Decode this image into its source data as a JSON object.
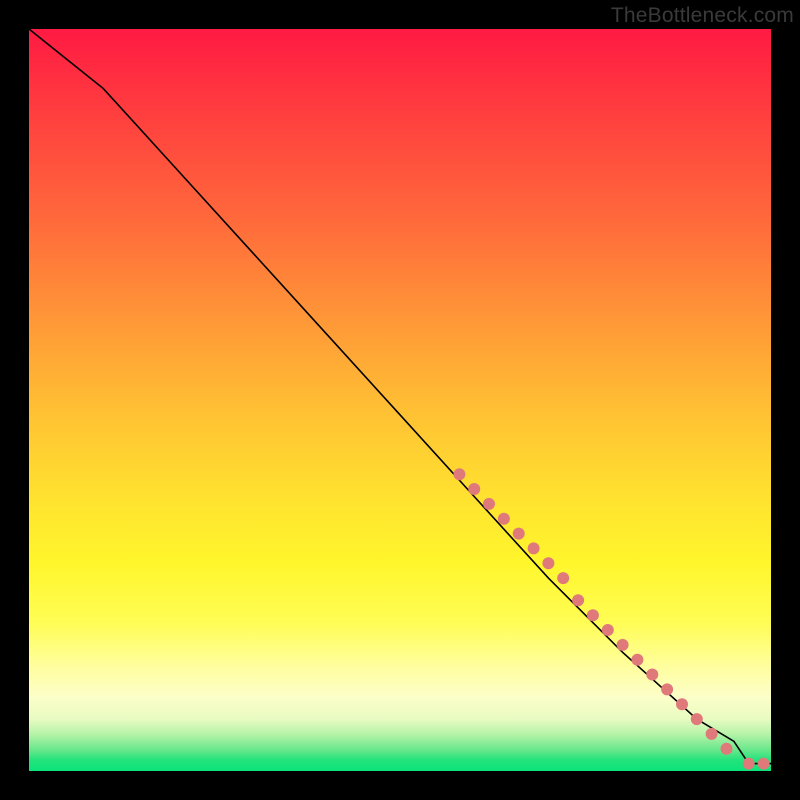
{
  "header": {
    "site_label": "TheBottleneck.com",
    "site_href": "#"
  },
  "colors": {
    "marker": "#e07a7a",
    "curve": "#000000",
    "gradient_top": "#ff1a43",
    "gradient_bottom": "#0be37a"
  },
  "chart_data": {
    "type": "line",
    "title": "",
    "xlabel": "",
    "ylabel": "",
    "xlim": [
      0,
      100
    ],
    "ylim": [
      0,
      100
    ],
    "grid": false,
    "legend": false,
    "note": "No axis ticks or labels visible; x/y in percent of plot area. y is shown inverted so 0 is top, 100 is bottom, matching the rendered image.",
    "curve": {
      "name": "bottleneck-curve",
      "x": [
        0,
        5,
        10,
        20,
        30,
        40,
        50,
        60,
        70,
        80,
        90,
        95,
        97,
        100
      ],
      "y": [
        0,
        4,
        8,
        19,
        30,
        41,
        52,
        63,
        74,
        84,
        93,
        96,
        99,
        99
      ]
    },
    "markers": {
      "name": "highlighted-points",
      "radius": 6,
      "points": [
        {
          "x": 58,
          "y": 60
        },
        {
          "x": 60,
          "y": 62
        },
        {
          "x": 62,
          "y": 64
        },
        {
          "x": 64,
          "y": 66
        },
        {
          "x": 66,
          "y": 68
        },
        {
          "x": 68,
          "y": 70
        },
        {
          "x": 70,
          "y": 72
        },
        {
          "x": 72,
          "y": 74
        },
        {
          "x": 74,
          "y": 77
        },
        {
          "x": 76,
          "y": 79
        },
        {
          "x": 78,
          "y": 81
        },
        {
          "x": 80,
          "y": 83
        },
        {
          "x": 82,
          "y": 85
        },
        {
          "x": 84,
          "y": 87
        },
        {
          "x": 86,
          "y": 89
        },
        {
          "x": 88,
          "y": 91
        },
        {
          "x": 90,
          "y": 93
        },
        {
          "x": 92,
          "y": 95
        },
        {
          "x": 94,
          "y": 97
        },
        {
          "x": 97,
          "y": 99
        },
        {
          "x": 99,
          "y": 99
        }
      ]
    }
  }
}
